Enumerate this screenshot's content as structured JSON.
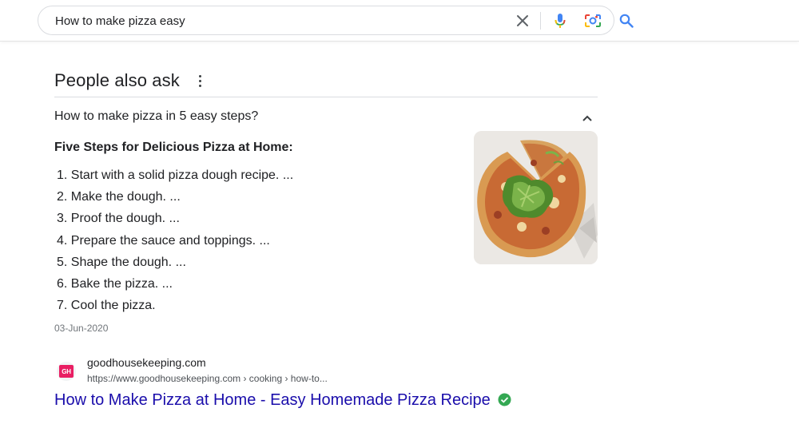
{
  "search": {
    "query": "How to make pizza easy"
  },
  "icons": {
    "clear": "close-icon",
    "mic": "mic-icon",
    "lens": "camera-lens-icon",
    "search": "search-icon",
    "more": "more-vert-icon",
    "collapse": "chevron-up-icon",
    "verified": "verified-check-icon"
  },
  "paa": {
    "title": "People also ask",
    "question": "How to make pizza in 5 easy steps?",
    "answer_heading": "Five Steps for Delicious Pizza at Home:",
    "steps": [
      "1. Start with a solid pizza dough recipe. ...",
      "2. Make the dough. ...",
      "3. Proof the dough. ...",
      "4. Prepare the sauce and toppings. ...",
      "5. Shape the dough. ...",
      "6. Bake the pizza. ...",
      "7. Cool the pizza."
    ],
    "date": "03-Jun-2020"
  },
  "source": {
    "favicon_text": "GH",
    "site": "goodhousekeeping.com",
    "url": "https://www.goodhousekeeping.com › cooking › how-to...",
    "title": "How to Make Pizza at Home - Easy Homemade Pizza Recipe"
  },
  "colors": {
    "link": "#1a0dab",
    "verified": "#34a853",
    "favicon": "#e91e63"
  }
}
